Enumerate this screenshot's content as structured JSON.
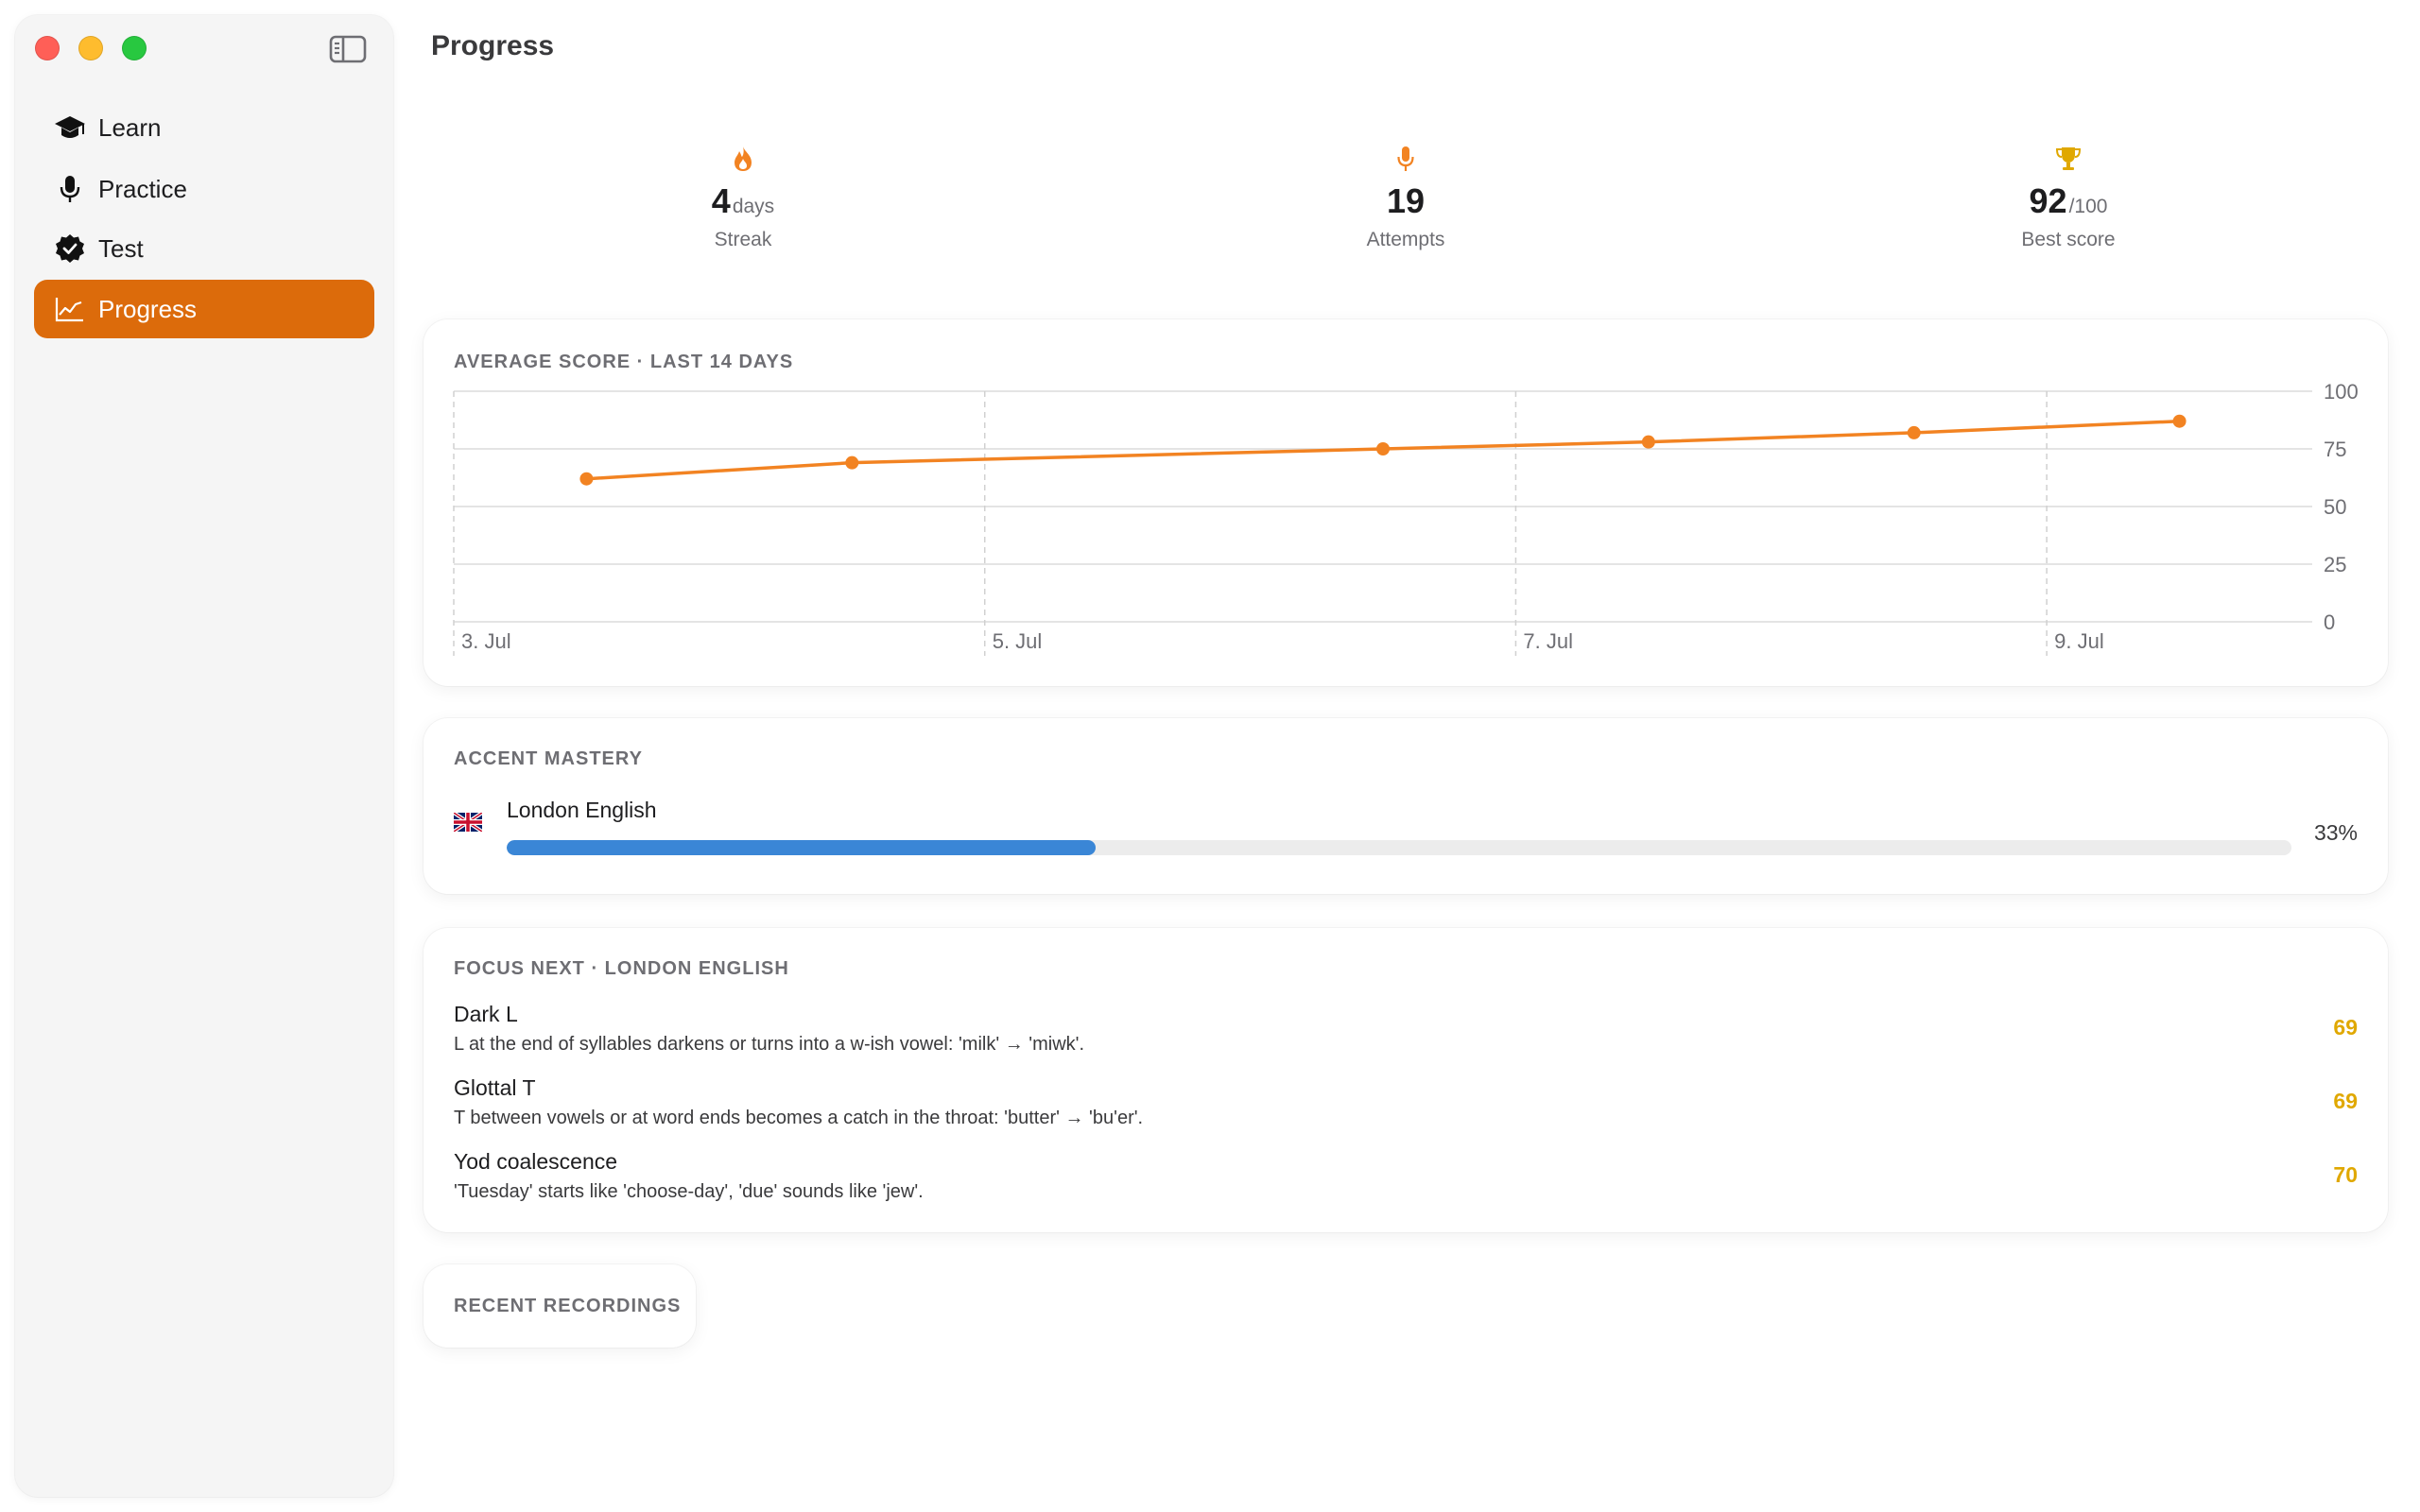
{
  "window": {
    "traffic_lights": [
      "close",
      "minimize",
      "zoom"
    ],
    "sidebar_toggle_icon": "sidebar-toggle-icon"
  },
  "sidebar": {
    "items": [
      {
        "label": "Learn",
        "icon": "graduation-cap-icon",
        "active": false
      },
      {
        "label": "Practice",
        "icon": "microphone-icon",
        "active": false
      },
      {
        "label": "Test",
        "icon": "checkmark-seal-icon",
        "active": false
      },
      {
        "label": "Progress",
        "icon": "chart-line-icon",
        "active": true
      }
    ]
  },
  "page": {
    "title": "Progress"
  },
  "stats": {
    "streak": {
      "icon": "flame-icon",
      "value": "4",
      "unit": "days",
      "label": "Streak"
    },
    "attempts": {
      "icon": "microphone-icon",
      "value": "19",
      "label": "Attempts"
    },
    "best": {
      "icon": "trophy-icon",
      "value": "92",
      "unit": "/100",
      "label": "Best score"
    }
  },
  "score_chart": {
    "title": "AVERAGE SCORE · LAST 14 DAYS"
  },
  "chart_data": {
    "type": "line",
    "title": "AVERAGE SCORE · LAST 14 DAYS",
    "x": [
      "3 Jul",
      "4 Jul",
      "6 Jul",
      "7 Jul",
      "8 Jul",
      "9 Jul"
    ],
    "values": [
      62,
      69,
      75,
      78,
      82,
      87
    ],
    "x_tick_labels": [
      "3. Jul",
      "5. Jul",
      "7. Jul",
      "9. Jul"
    ],
    "y_ticks": [
      0,
      25,
      50,
      75,
      100
    ],
    "ylim": [
      0,
      100
    ],
    "color": "#f28322",
    "grid": true
  },
  "accent_mastery": {
    "title": "ACCENT MASTERY",
    "items": [
      {
        "flag": "uk-flag-icon",
        "name": "London English",
        "percent_label": "33%",
        "progress": 0.33,
        "bar_color": "#3a86d6"
      }
    ]
  },
  "focus_next": {
    "title": "FOCUS NEXT · LONDON ENGLISH",
    "items": [
      {
        "name": "Dark L",
        "description": "L at the end of syllables darkens or turns into a w-ish vowel: 'milk' → 'miwk'.",
        "score": "69"
      },
      {
        "name": "Glottal T",
        "description": "T between vowels or at word ends becomes a catch in the throat: 'butter' → 'bu'er'.",
        "score": "69"
      },
      {
        "name": "Yod coalescence",
        "description": "'Tuesday' starts like 'choose-day', 'due' sounds like 'jew'.",
        "score": "70"
      }
    ],
    "score_color": "#e0a800"
  },
  "recent_recordings": {
    "title": "RECENT RECORDINGS"
  },
  "colors": {
    "accent": "#dc6b0b",
    "chart_line": "#f28322",
    "progress_bar": "#3a86d6",
    "score": "#e0a800"
  }
}
